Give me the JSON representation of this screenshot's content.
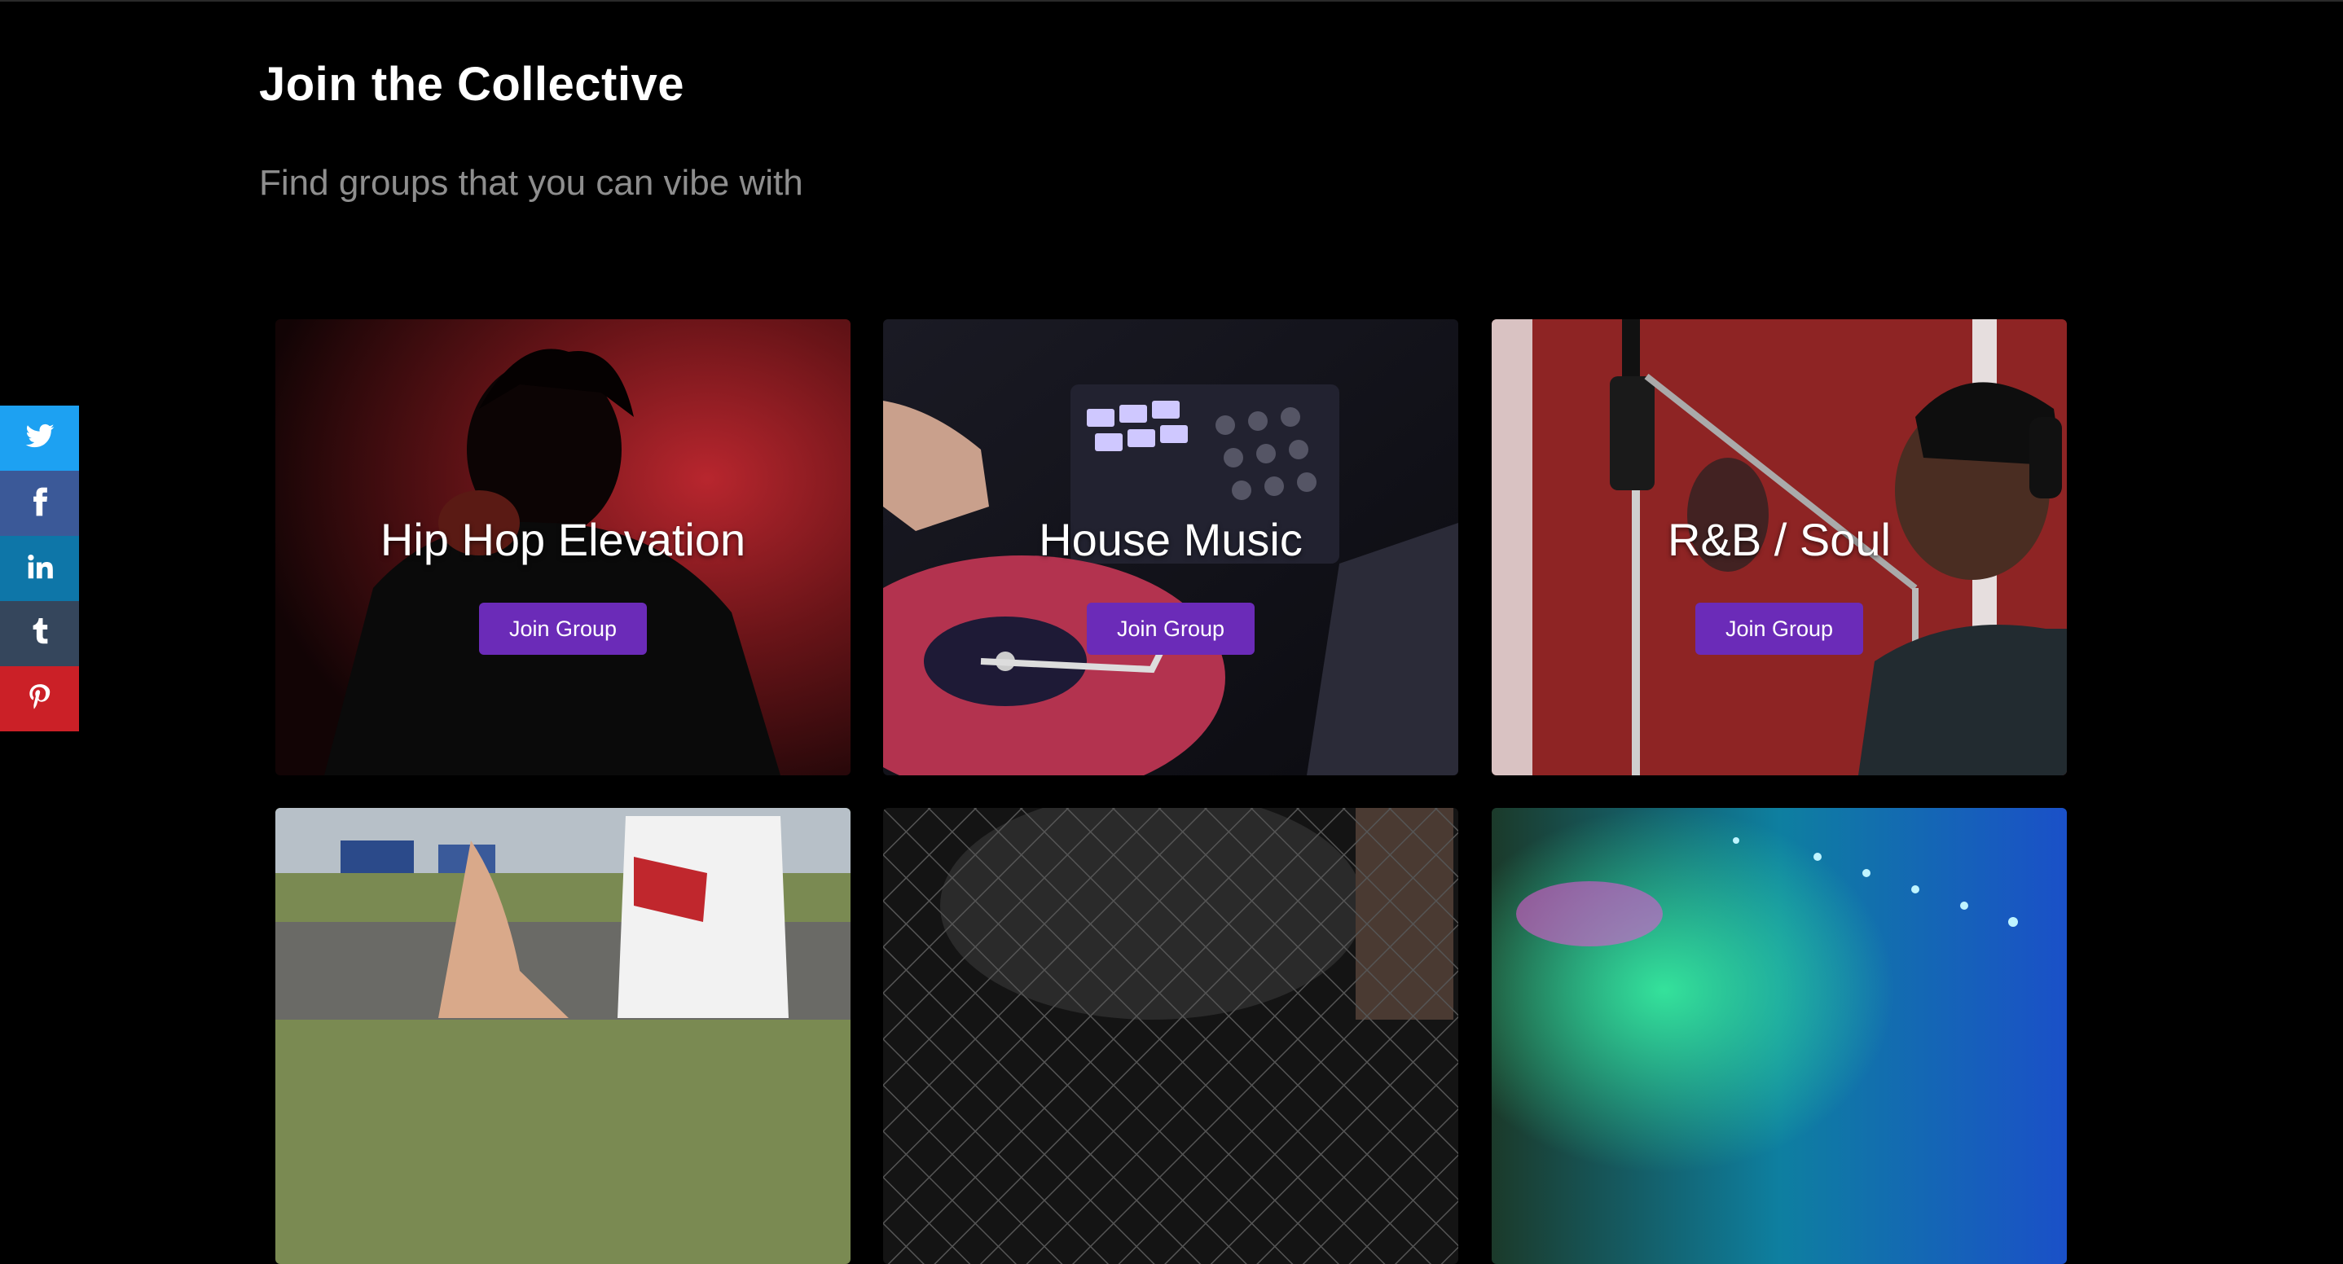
{
  "header": {
    "title": "Join the Collective",
    "subtitle": "Find groups that you can vibe with"
  },
  "share_bar": {
    "items": [
      {
        "icon": "twitter-icon",
        "color": "#1da1f2"
      },
      {
        "icon": "facebook-icon",
        "color": "#3b5998"
      },
      {
        "icon": "linkedin-icon",
        "color": "#0e76a8"
      },
      {
        "icon": "tumblr-icon",
        "color": "#35465c"
      },
      {
        "icon": "pinterest-icon",
        "color": "#cb2027"
      }
    ]
  },
  "groups": [
    {
      "title": "Hip Hop Elevation",
      "button": "Join Group"
    },
    {
      "title": "House Music",
      "button": "Join Group"
    },
    {
      "title": "R&B / Soul",
      "button": "Join Group"
    },
    {
      "title": "",
      "button": ""
    },
    {
      "title": "",
      "button": ""
    },
    {
      "title": "",
      "button": ""
    }
  ],
  "colors": {
    "accent": "#6b2bb8",
    "background": "#000000",
    "subtitle": "#8e8e8e"
  }
}
